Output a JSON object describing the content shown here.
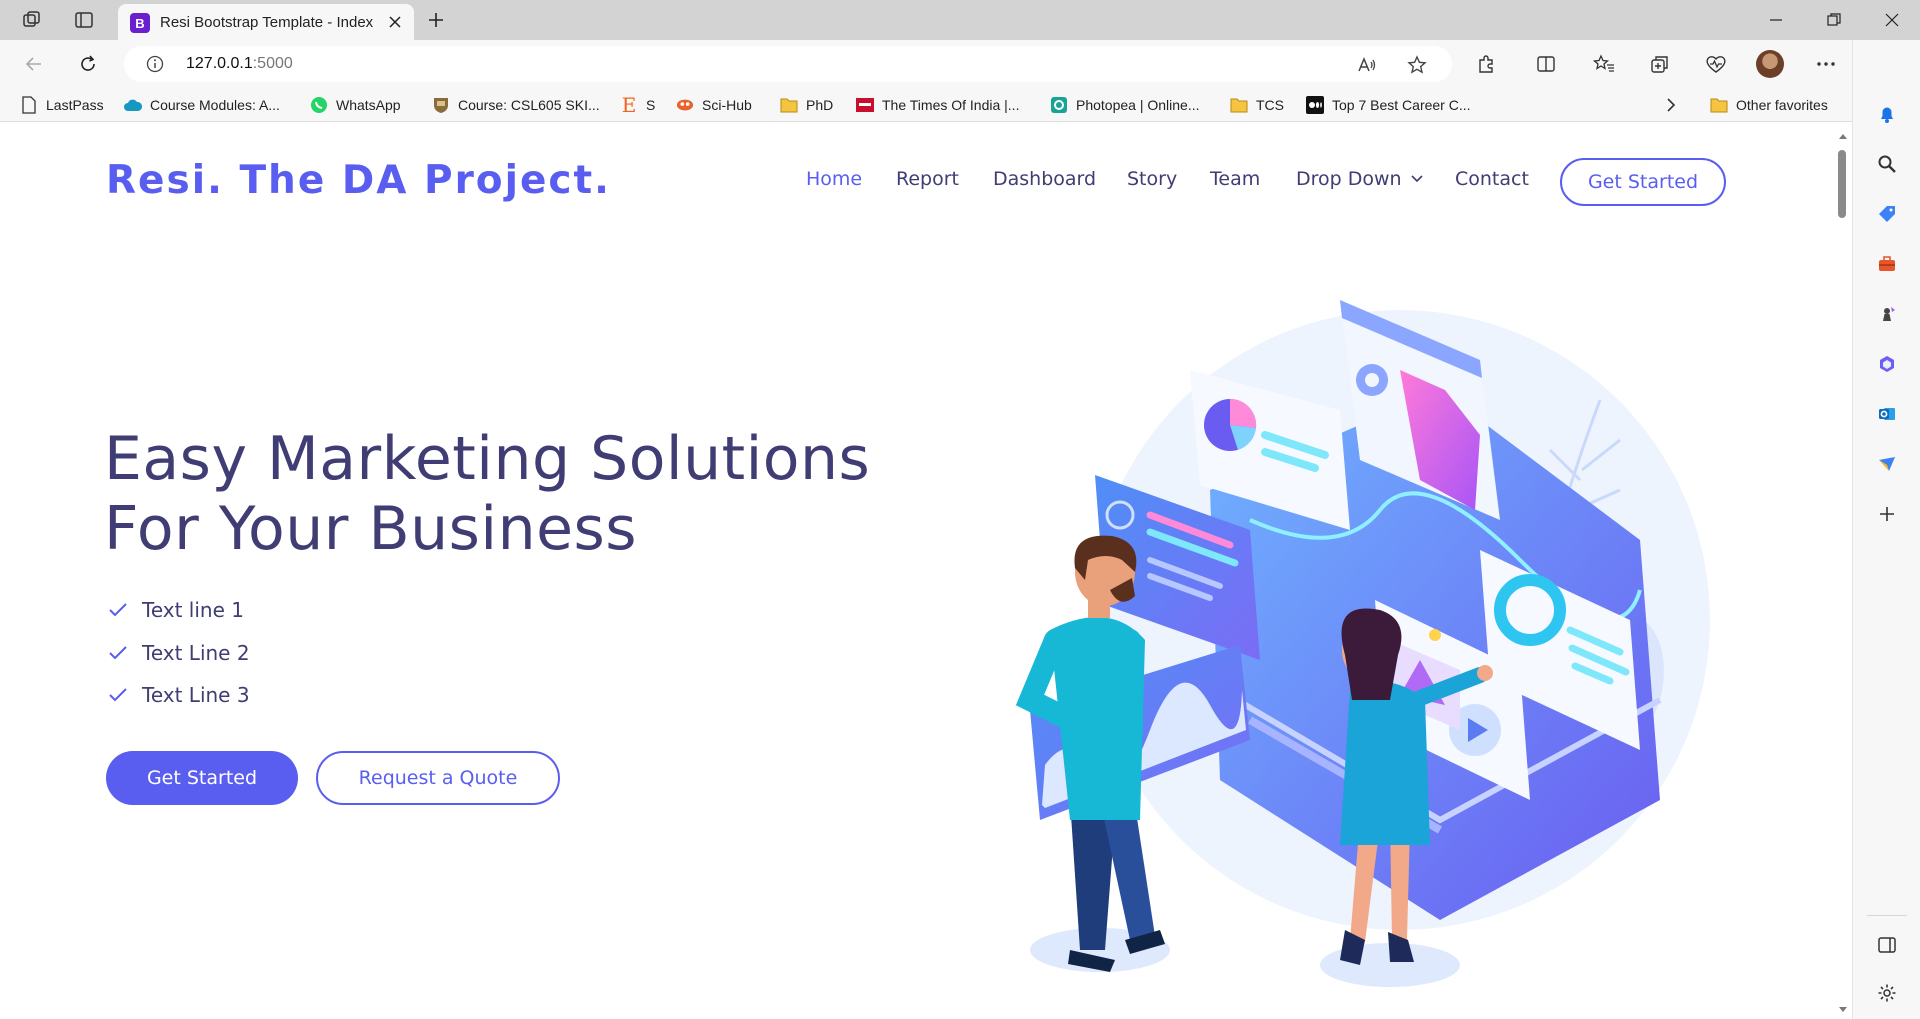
{
  "browser": {
    "tab": {
      "title": "Resi Bootstrap Template - Index",
      "favicon_letter": "B"
    },
    "address": {
      "host": "127.0.0.1",
      "port": ":5000"
    },
    "bookmarks": [
      {
        "label": "LastPass",
        "icon": "document-icon"
      },
      {
        "label": "Course Modules: A...",
        "icon": "cloud-icon"
      },
      {
        "label": "WhatsApp",
        "icon": "whatsapp-icon"
      },
      {
        "label": "Course: CSL605 SKI...",
        "icon": "crest-icon"
      },
      {
        "label": "S",
        "icon": "etsy-icon"
      },
      {
        "label": "Sci-Hub",
        "icon": "scihub-icon"
      },
      {
        "label": "PhD",
        "icon": "folder-icon"
      },
      {
        "label": "The Times Of India |...",
        "icon": "toi-icon"
      },
      {
        "label": "Photopea | Online...",
        "icon": "photopea-icon"
      },
      {
        "label": "TCS",
        "icon": "folder-icon"
      },
      {
        "label": "Top 7 Best Career C...",
        "icon": "medium-icon"
      }
    ],
    "other_favorites": "Other favorites"
  },
  "site": {
    "logo": "Resi. The DA Project.",
    "nav": [
      {
        "label": "Home",
        "active": true
      },
      {
        "label": "Report"
      },
      {
        "label": "Dashboard"
      },
      {
        "label": "Story"
      },
      {
        "label": "Team"
      },
      {
        "label": "Drop Down",
        "dropdown": true
      },
      {
        "label": "Contact"
      }
    ],
    "cta": "Get Started"
  },
  "hero": {
    "title_line1": "Easy Marketing Solutions",
    "title_line2": "For Your Business",
    "checklist": [
      "Text line 1",
      "Text Line 2",
      "Text Line 3"
    ],
    "primary_button": "Get Started",
    "secondary_button": "Request a Quote"
  },
  "colors": {
    "accent": "#5a5ef0",
    "heading": "#3f3d73"
  }
}
